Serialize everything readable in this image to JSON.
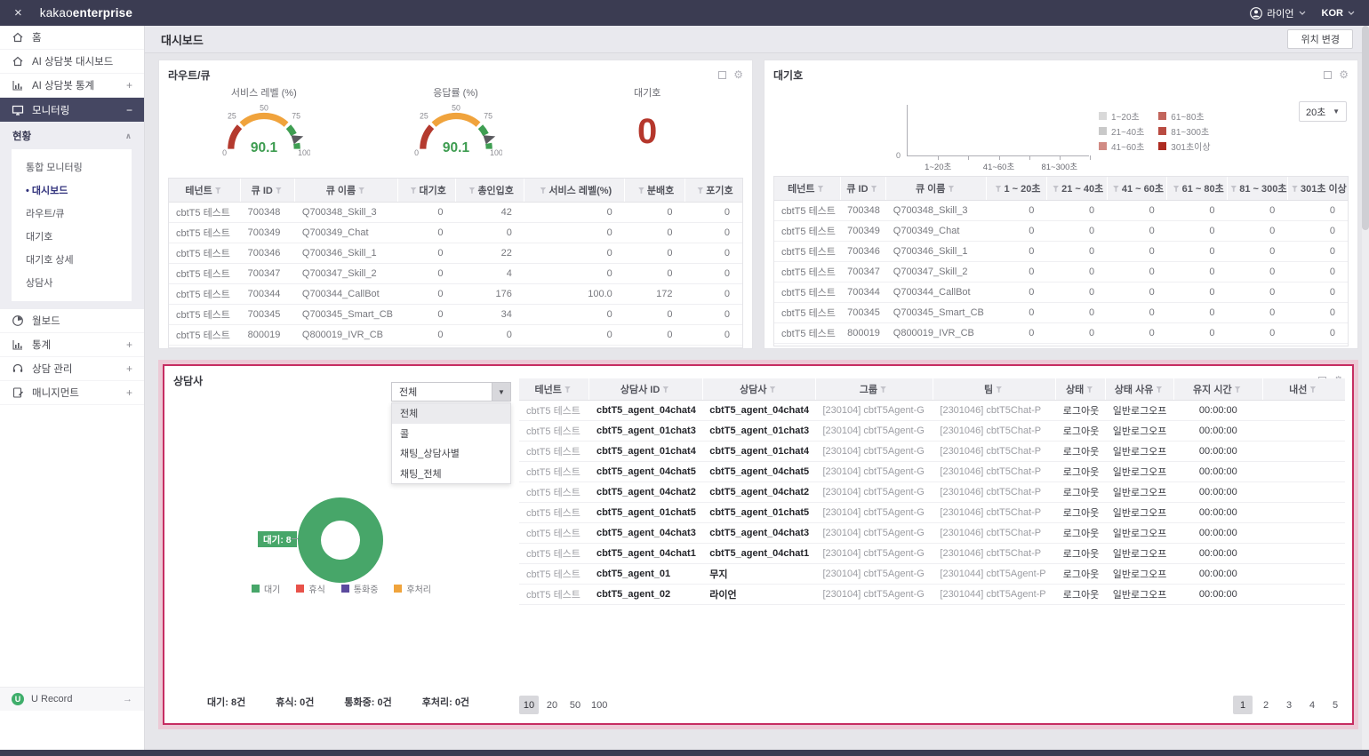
{
  "topbar": {
    "logo_regular": "kakao",
    "logo_bold": "enterprise",
    "user_name": "라이언",
    "language": "KOR"
  },
  "page": {
    "title": "대시보드",
    "location_button": "위치 변경"
  },
  "sidebar": {
    "items": [
      {
        "label": "홈"
      },
      {
        "label": "AI 상담봇 대시보드"
      },
      {
        "label": "AI 상담봇 통계",
        "toggle": "+"
      },
      {
        "label": "모니터링",
        "toggle": "−"
      },
      {
        "label": "월보드"
      },
      {
        "label": "통계",
        "toggle": "+"
      },
      {
        "label": "상담 관리",
        "toggle": "+"
      },
      {
        "label": "매니지먼트",
        "toggle": "+"
      }
    ],
    "status_header": "현황",
    "submenu": [
      {
        "label": "통합 모니터링",
        "active": false
      },
      {
        "label": "대시보드",
        "active": true
      },
      {
        "label": "라우트/큐",
        "active": false
      },
      {
        "label": "대기호",
        "active": false
      },
      {
        "label": "대기호 상세",
        "active": false
      },
      {
        "label": "상담사",
        "active": false
      }
    ],
    "urecord_label": "U Record"
  },
  "route_queue_panel": {
    "title": "라우트/큐"
  },
  "wait_panel": {
    "title": "대기호",
    "interval_value": "20초"
  },
  "agents_panel": {
    "title": "상담사",
    "filter": {
      "value": "전체",
      "selected_option": "전체",
      "options": [
        "전체",
        "콜",
        "채팅_상담사별",
        "채팅_전체"
      ]
    },
    "stats": [
      "대기: 8건",
      "휴식: 0건",
      "통화중: 0건",
      "후처리: 0건"
    ],
    "page_sizes": [
      "10",
      "20",
      "50",
      "100"
    ],
    "active_page_size": "10",
    "pages": [
      "1",
      "2",
      "3",
      "4",
      "5"
    ],
    "active_page": "1"
  },
  "charts": {
    "service_level_gauge": {
      "type": "gauge",
      "title": "서비스 레벨 (%)",
      "value": 90.1,
      "min": 0,
      "max": 100,
      "ticks": [
        0,
        25,
        50,
        75,
        100
      ]
    },
    "answer_rate_gauge": {
      "type": "gauge",
      "title": "응답률 (%)",
      "value": 90.1,
      "min": 0,
      "max": 100,
      "ticks": [
        0,
        25,
        50,
        75,
        100
      ]
    },
    "waiting_calls": {
      "title": "대기호",
      "value": "0"
    },
    "wait_time_bar": {
      "type": "bar",
      "categories": [
        "1~20초",
        "21~40초",
        "41~60초",
        "61~80초",
        "81~300초",
        "301초이상"
      ],
      "values": [
        0,
        0,
        0,
        0,
        0,
        0
      ],
      "x_tick_labels": [
        "1~20초",
        "41~60초",
        "81~300초"
      ],
      "y_ticks": [
        0
      ],
      "legend": [
        {
          "label": "1~20초",
          "color": "#d9d9d9"
        },
        {
          "label": "21~40초",
          "color": "#c9c9c9"
        },
        {
          "label": "41~60초",
          "color": "#d18b84"
        },
        {
          "label": "61~80초",
          "color": "#c2655c"
        },
        {
          "label": "81~300초",
          "color": "#b94b41"
        },
        {
          "label": "301초이상",
          "color": "#ad2b21"
        }
      ]
    },
    "agent_status_donut": {
      "type": "donut",
      "callout": "대기: 8",
      "slices": [
        {
          "label": "대기",
          "value": 8,
          "color": "#47a669"
        },
        {
          "label": "휴식",
          "value": 0,
          "color": "#e8524a"
        },
        {
          "label": "통화중",
          "value": 0,
          "color": "#5b4a9e"
        },
        {
          "label": "후처리",
          "value": 0,
          "color": "#f0a43c"
        }
      ]
    }
  },
  "tables": {
    "route_queue": {
      "columns": [
        {
          "label": "테넌트",
          "numeric": false
        },
        {
          "label": "큐 ID",
          "numeric": false
        },
        {
          "label": "큐 이름",
          "numeric": false
        },
        {
          "label": "대기호",
          "numeric": true
        },
        {
          "label": "총인입호",
          "numeric": true
        },
        {
          "label": "서비스 레벨(%)",
          "numeric": true
        },
        {
          "label": "분배호",
          "numeric": true
        },
        {
          "label": "포기호",
          "numeric": true
        }
      ],
      "rows": [
        [
          "cbtT5 테스트",
          "700348",
          "Q700348_Skill_3",
          "0",
          "42",
          "0",
          "0",
          "0"
        ],
        [
          "cbtT5 테스트",
          "700349",
          "Q700349_Chat",
          "0",
          "0",
          "0",
          "0",
          "0"
        ],
        [
          "cbtT5 테스트",
          "700346",
          "Q700346_Skill_1",
          "0",
          "22",
          "0",
          "0",
          "0"
        ],
        [
          "cbtT5 테스트",
          "700347",
          "Q700347_Skill_2",
          "0",
          "4",
          "0",
          "0",
          "0"
        ],
        [
          "cbtT5 테스트",
          "700344",
          "Q700344_CallBot",
          "0",
          "176",
          "100.0",
          "172",
          "0"
        ],
        [
          "cbtT5 테스트",
          "700345",
          "Q700345_Smart_CB",
          "0",
          "34",
          "0",
          "0",
          "0"
        ],
        [
          "cbtT5 테스트",
          "800019",
          "Q800019_IVR_CB",
          "0",
          "0",
          "0",
          "0",
          "0"
        ]
      ]
    },
    "wait_calls": {
      "columns": [
        {
          "label": "테넌트",
          "numeric": false
        },
        {
          "label": "큐 ID",
          "numeric": false
        },
        {
          "label": "큐 이름",
          "numeric": false
        },
        {
          "label": "1 ~ 20초",
          "numeric": true
        },
        {
          "label": "21 ~ 40초",
          "numeric": true
        },
        {
          "label": "41 ~ 60초",
          "numeric": true
        },
        {
          "label": "61 ~ 80초",
          "numeric": true
        },
        {
          "label": "81 ~ 300초",
          "numeric": true
        },
        {
          "label": "301초 이상",
          "numeric": true
        }
      ],
      "rows": [
        [
          "cbtT5 테스트",
          "700348",
          "Q700348_Skill_3",
          "0",
          "0",
          "0",
          "0",
          "0",
          "0"
        ],
        [
          "cbtT5 테스트",
          "700349",
          "Q700349_Chat",
          "0",
          "0",
          "0",
          "0",
          "0",
          "0"
        ],
        [
          "cbtT5 테스트",
          "700346",
          "Q700346_Skill_1",
          "0",
          "0",
          "0",
          "0",
          "0",
          "0"
        ],
        [
          "cbtT5 테스트",
          "700347",
          "Q700347_Skill_2",
          "0",
          "0",
          "0",
          "0",
          "0",
          "0"
        ],
        [
          "cbtT5 테스트",
          "700344",
          "Q700344_CallBot",
          "0",
          "0",
          "0",
          "0",
          "0",
          "0"
        ],
        [
          "cbtT5 테스트",
          "700345",
          "Q700345_Smart_CB",
          "0",
          "0",
          "0",
          "0",
          "0",
          "0"
        ],
        [
          "cbtT5 테스트",
          "800019",
          "Q800019_IVR_CB",
          "0",
          "0",
          "0",
          "0",
          "0",
          "0"
        ]
      ]
    },
    "agents": {
      "columns": [
        {
          "label": "테넌트",
          "numeric": false
        },
        {
          "label": "상담사 ID",
          "numeric": false
        },
        {
          "label": "상담사",
          "numeric": false
        },
        {
          "label": "그룹",
          "numeric": false
        },
        {
          "label": "팀",
          "numeric": false
        },
        {
          "label": "상태",
          "numeric": false
        },
        {
          "label": "상태 사유",
          "numeric": false
        },
        {
          "label": "유지 시간",
          "numeric": false
        },
        {
          "label": "내선",
          "numeric": false
        }
      ],
      "rows": [
        [
          "cbtT5 테스트",
          "cbtT5_agent_04chat4",
          "cbtT5_agent_04chat4",
          "[230104] cbtT5Agent-G",
          "[2301046] cbtT5Chat-P",
          "로그아웃",
          "일반로그오프",
          "00:00:00",
          ""
        ],
        [
          "cbtT5 테스트",
          "cbtT5_agent_01chat3",
          "cbtT5_agent_01chat3",
          "[230104] cbtT5Agent-G",
          "[2301046] cbtT5Chat-P",
          "로그아웃",
          "일반로그오프",
          "00:00:00",
          ""
        ],
        [
          "cbtT5 테스트",
          "cbtT5_agent_01chat4",
          "cbtT5_agent_01chat4",
          "[230104] cbtT5Agent-G",
          "[2301046] cbtT5Chat-P",
          "로그아웃",
          "일반로그오프",
          "00:00:00",
          ""
        ],
        [
          "cbtT5 테스트",
          "cbtT5_agent_04chat5",
          "cbtT5_agent_04chat5",
          "[230104] cbtT5Agent-G",
          "[2301046] cbtT5Chat-P",
          "로그아웃",
          "일반로그오프",
          "00:00:00",
          ""
        ],
        [
          "cbtT5 테스트",
          "cbtT5_agent_04chat2",
          "cbtT5_agent_04chat2",
          "[230104] cbtT5Agent-G",
          "[2301046] cbtT5Chat-P",
          "로그아웃",
          "일반로그오프",
          "00:00:00",
          ""
        ],
        [
          "cbtT5 테스트",
          "cbtT5_agent_01chat5",
          "cbtT5_agent_01chat5",
          "[230104] cbtT5Agent-G",
          "[2301046] cbtT5Chat-P",
          "로그아웃",
          "일반로그오프",
          "00:00:00",
          ""
        ],
        [
          "cbtT5 테스트",
          "cbtT5_agent_04chat3",
          "cbtT5_agent_04chat3",
          "[230104] cbtT5Agent-G",
          "[2301046] cbtT5Chat-P",
          "로그아웃",
          "일반로그오프",
          "00:00:00",
          ""
        ],
        [
          "cbtT5 테스트",
          "cbtT5_agent_04chat1",
          "cbtT5_agent_04chat1",
          "[230104] cbtT5Agent-G",
          "[2301046] cbtT5Chat-P",
          "로그아웃",
          "일반로그오프",
          "00:00:00",
          ""
        ],
        [
          "cbtT5 테스트",
          "cbtT5_agent_01",
          "무지",
          "[230104] cbtT5Agent-G",
          "[2301044] cbtT5Agent-P",
          "로그아웃",
          "일반로그오프",
          "00:00:00",
          ""
        ],
        [
          "cbtT5 테스트",
          "cbtT5_agent_02",
          "라이언",
          "[230104] cbtT5Agent-G",
          "[2301044] cbtT5Agent-P",
          "로그아웃",
          "일반로그오프",
          "00:00:00",
          ""
        ]
      ]
    }
  }
}
